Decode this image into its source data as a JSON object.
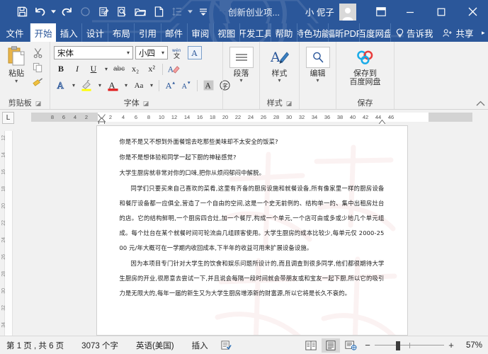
{
  "titlebar": {
    "quick_access": [
      {
        "name": "save-icon",
        "label": "保存"
      },
      {
        "name": "undo-icon",
        "label": "撤销"
      },
      {
        "name": "redo-icon",
        "label": "恢复"
      },
      {
        "name": "circle-icon",
        "label": "圆形"
      },
      {
        "name": "edit-document-icon",
        "label": "编辑文档"
      },
      {
        "name": "print-preview-icon",
        "label": "打印预览"
      },
      {
        "name": "open-folder-icon",
        "label": "打开"
      },
      {
        "name": "new-document-icon",
        "label": "新建"
      },
      {
        "name": "line-spacing-icon",
        "label": "行距"
      }
    ],
    "document_title": "创新创业项...",
    "user_name": "小 伲子",
    "ribbon_display_options": "功能区显示选项",
    "minimize": "—",
    "maximize": "☐",
    "close": "✕"
  },
  "tabs": [
    {
      "label": "文件",
      "active": false,
      "name": "tab-file"
    },
    {
      "label": "开始",
      "active": true,
      "name": "tab-home"
    },
    {
      "label": "插入",
      "active": false,
      "name": "tab-insert"
    },
    {
      "label": "设计",
      "active": false,
      "name": "tab-design"
    },
    {
      "label": "布局",
      "active": false,
      "name": "tab-layout"
    },
    {
      "label": "引用",
      "active": false,
      "name": "tab-references"
    },
    {
      "label": "邮件",
      "active": false,
      "name": "tab-mailings"
    },
    {
      "label": "审阅",
      "active": false,
      "name": "tab-review"
    },
    {
      "label": "视图",
      "active": false,
      "name": "tab-view"
    },
    {
      "label": "开发工具",
      "active": false,
      "name": "tab-developer"
    },
    {
      "label": "帮助",
      "active": false,
      "name": "tab-help"
    },
    {
      "label": "特色功能",
      "active": false,
      "name": "tab-features"
    },
    {
      "label": "福昕PDF",
      "active": false,
      "name": "tab-foxit-pdf"
    },
    {
      "label": "百度网盘",
      "active": false,
      "name": "tab-baidu-netdisk"
    }
  ],
  "tell_me": "告诉我",
  "share": "共享",
  "ribbon": {
    "clipboard": {
      "group_label": "剪贴板",
      "paste_label": "粘贴",
      "cut_label": "剪切",
      "copy_label": "复制",
      "format_painter_label": "格式刷"
    },
    "font": {
      "group_label": "字体",
      "font_name": "宋体",
      "font_size": "小四",
      "phonetic_guide": "拼音指南",
      "char_border": "字符边框",
      "bold": "B",
      "italic": "I",
      "underline": "U",
      "strikethrough": "abc",
      "subscript": "x₂",
      "superscript": "x²",
      "clear_format": "清除所有格式",
      "text_effects": "文本效果",
      "highlight": "以不同颜色突出显示文本",
      "font_color": "字体颜色",
      "change_case": "Aa",
      "grow_font": "A",
      "shrink_font": "A",
      "char_shading": "字符底纹",
      "enclose_char": "带圈字符"
    },
    "paragraph": {
      "group_label": "段落",
      "button_label": "段落"
    },
    "styles": {
      "group_label": "样式",
      "button_label": "样式"
    },
    "editing": {
      "group_label": "",
      "button_label": "编辑"
    },
    "save_group": {
      "group_label": "保存",
      "button_label_line1": "保存到",
      "button_label_line2": "百度网盘"
    }
  },
  "ruler": {
    "tab_selector": "L",
    "horizontal_numbers": [
      "8",
      "6",
      "4",
      "2",
      "2",
      "4",
      "6",
      "8",
      "10",
      "12",
      "14",
      "16",
      "18",
      "20",
      "22",
      "24",
      "26",
      "28",
      "30",
      "32",
      "34",
      "36",
      "38",
      "40",
      "42",
      "44",
      "46"
    ],
    "vertical_numbers": [
      "12",
      "14",
      "16",
      "18",
      "20",
      "22",
      "24",
      "26",
      "28",
      "30",
      "32",
      "34",
      "36"
    ]
  },
  "document": {
    "paragraphs": [
      {
        "text": "你是不是又不想到外面餐馆去吃那些美味却不太安全的饭菜?",
        "indent": false
      },
      {
        "text": "你是不是想体验和同学一起下厨的神秘感觉?",
        "indent": false
      },
      {
        "text": "大学生厨房就非常对你的口味,把你从烦闷郁闷中解脱。",
        "indent": false
      },
      {
        "text": "同学们只要买来自己喜欢的菜肴,这里有齐备的厨房设施和就餐设备,所有像家里一样的厨房设备和餐厅设备都一应俱全,营造了一个自由的空间,这是一个史无前例的、结构单一的、集中出租房灶台的店。它的结构鲜明,一个厨房四合灶,加一个餐厅,构成一个单元,一个店可由或多或少地几个单元组成。每个灶台在某个就餐时间可轮流由几组顾客使用。大学生厨房的成本比较少,每单元仅 2000-2500 元/年大概可在一学期内收回成本,下半年的收益可用来扩展设备设施。",
        "indent": true
      },
      {
        "text": "因为本项目专门针对大学生的饮食和娱乐问题所设计的,而且调查到很多同学,他们都很期待大学生厨房的开业,很愿意去尝试一下,并且说会每隔一段时间就会带朋友或和宝友一起下厨,所以它的吸引力是无限大的,每年一届的新生又为大学生厨房增添新的财富源,所以它将是长久不衰的。",
        "indent": true
      }
    ]
  },
  "statusbar": {
    "page_info": "第 1 页 , 共 6 页",
    "word_count": "3073 个字",
    "language": "英语(美国)",
    "insert_mode": "插入",
    "proofing_icon": "proofing-errors-icon",
    "view_read_mode": "阅读视图",
    "view_print_layout": "页面视图",
    "view_web_layout": "Web版式视图",
    "zoom_out": "−",
    "zoom_in": "+",
    "zoom_percent": "57%"
  },
  "colors": {
    "title_bar": "#2b579a",
    "ribbon_bg": "#f1f1f1",
    "accent": "#2b579a",
    "page_bg": "#ffffff",
    "canvas_bg": "#f1f1f1"
  }
}
